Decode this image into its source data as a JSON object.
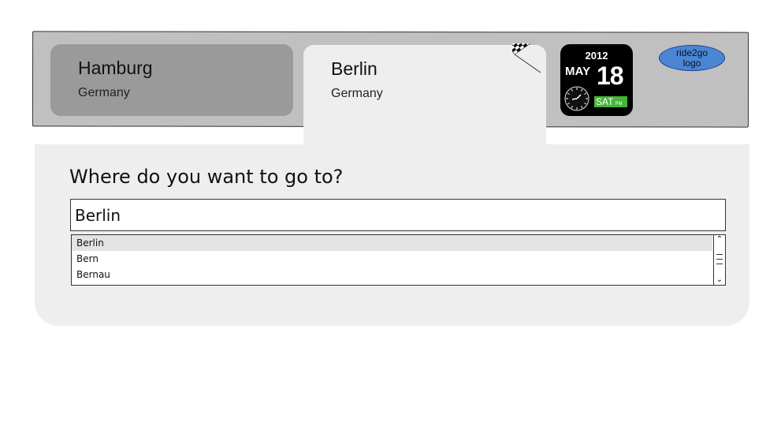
{
  "trip": {
    "origin": {
      "city": "Hamburg",
      "country": "Germany"
    },
    "destination": {
      "city": "Berlin",
      "country": "Germany"
    }
  },
  "calendar": {
    "year": "2012",
    "month": "MAY",
    "day": "18",
    "weekday": "SAT",
    "period": "PM"
  },
  "logo": {
    "line1": "ride2go",
    "line2": "logo"
  },
  "form": {
    "question": "Where do you want to go to?",
    "search_value": "Berlin",
    "suggestions": [
      "Berlin",
      "Bern",
      "Bernau"
    ]
  },
  "icons": {
    "flag": "checkered-flag-icon",
    "clock": "clock-icon"
  },
  "colors": {
    "header_bg": "#c0c0c0",
    "origin_tab": "#9a9a9a",
    "panel_bg": "#eeeeee",
    "logo_fill": "#4a86d4",
    "weekday_badge": "#46b53a"
  }
}
